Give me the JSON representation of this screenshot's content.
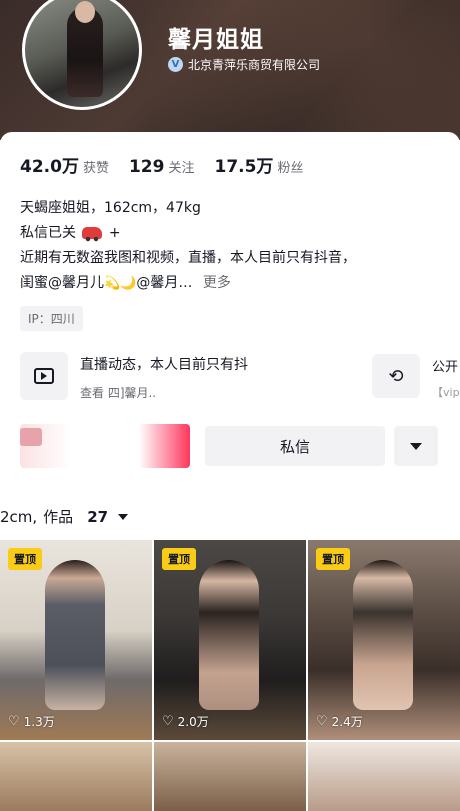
{
  "profile": {
    "nickname": "馨月姐姐",
    "org": "北京青萍乐商贸有限公司",
    "verify_icon": "v-verified-icon"
  },
  "stats": [
    {
      "value": "42.0万",
      "label": "获赞"
    },
    {
      "value": "129",
      "label": "关注"
    },
    {
      "value": "17.5万",
      "label": "粉丝"
    }
  ],
  "bio": {
    "line1": "天蝎座姐姐，162cm，47kg",
    "line2_text": "私信已关",
    "line2_suffix": "+",
    "line3": "近期有无数盗我图和视频，直播，本人目前只有抖音，",
    "line4_a": "闺蜜@馨月儿",
    "line4_b": "@馨月…",
    "more": "更多"
  },
  "ip": "IP：四川",
  "live": {
    "title": "直播动态，本人目前只有抖",
    "subtitle": "查看  四]馨月.."
  },
  "side": {
    "title": "公开",
    "subtitle": "【vip"
  },
  "actions": {
    "message": "私信"
  },
  "works": {
    "prefix": "2cm,",
    "label": "作品",
    "count": "27"
  },
  "posts": [
    {
      "pinned": "置顶",
      "likes": "1.3万"
    },
    {
      "pinned": "置顶",
      "likes": "2.0万"
    },
    {
      "pinned": "置顶",
      "likes": "2.4万"
    }
  ],
  "colors": {
    "pin": "#facc15",
    "accent": "#fe2c55"
  }
}
